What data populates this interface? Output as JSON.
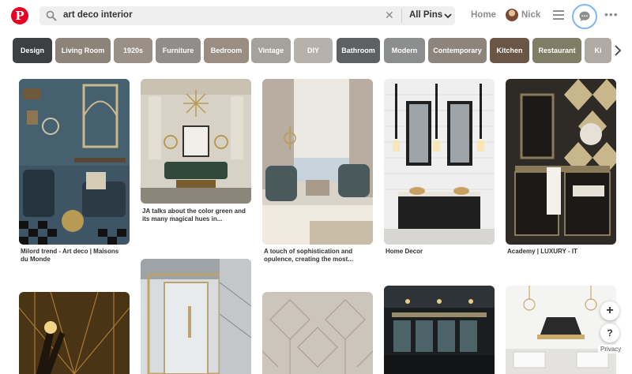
{
  "header": {
    "logo_letter": "P",
    "search": {
      "query": "art deco interior",
      "scope": "All Pins"
    },
    "nav": {
      "home": "Home",
      "user_name": "Nick"
    },
    "accent": "#e60023"
  },
  "chips": [
    {
      "label": "Design",
      "color": "#3d3f42"
    },
    {
      "label": "Living Room",
      "color": "#8c8478"
    },
    {
      "label": "1920s",
      "color": "#9a9086"
    },
    {
      "label": "Furniture",
      "color": "#8f8e8a"
    },
    {
      "label": "Bedroom",
      "color": "#9a8e82"
    },
    {
      "label": "Vintage",
      "color": "#a4a29c"
    },
    {
      "label": "DIY",
      "color": "#b6b1ab"
    },
    {
      "label": "Bathroom",
      "color": "#5e6163"
    },
    {
      "label": "Modern",
      "color": "#8c8d8d"
    },
    {
      "label": "Contemporary",
      "color": "#8d857c"
    },
    {
      "label": "Kitchen",
      "color": "#6b5646"
    },
    {
      "label": "Restaurant",
      "color": "#7f7d66"
    },
    {
      "label": "Ki",
      "color": "#b0aaa4"
    }
  ],
  "pins": [
    {
      "caption": "Milord trend - Art deco | Maisons du Monde",
      "palette": [
        "#3e5566",
        "#c9b98c",
        "#2b2b2b"
      ]
    },
    {
      "caption": "JA talks about the color green and its many magical hues in...",
      "palette": [
        "#d8d2c6",
        "#2f4a3a",
        "#b89a55"
      ]
    },
    {
      "caption": "A touch of sophistication and opulence, creating the most...",
      "palette": [
        "#d9d3ca",
        "#4a5a5c",
        "#a89a8a"
      ]
    },
    {
      "caption": "Home Decor",
      "palette": [
        "#efefef",
        "#1f1f1f",
        "#c8a060"
      ]
    },
    {
      "caption": "Academy | LUXURY - IT",
      "palette": [
        "#2e2b27",
        "#c8b78a",
        "#8a7a5a"
      ]
    },
    {
      "caption": "",
      "palette": [
        "#4a3416",
        "#a87a35",
        "#1e150b"
      ]
    },
    {
      "caption": "",
      "palette": [
        "#d9dcdf",
        "#bfa36a",
        "#7c7f82"
      ]
    },
    {
      "caption": "",
      "palette": [
        "#cbc5bb",
        "#e0dad0",
        "#a69c8e"
      ]
    },
    {
      "caption": "",
      "palette": [
        "#1b1e20",
        "#4c6468",
        "#9a8b6a"
      ]
    },
    {
      "caption": "",
      "palette": [
        "#f4f4f2",
        "#2a2a2a",
        "#c9ab6b"
      ]
    }
  ],
  "fab": {
    "plus": "+",
    "help": "?",
    "privacy": "Privacy"
  }
}
